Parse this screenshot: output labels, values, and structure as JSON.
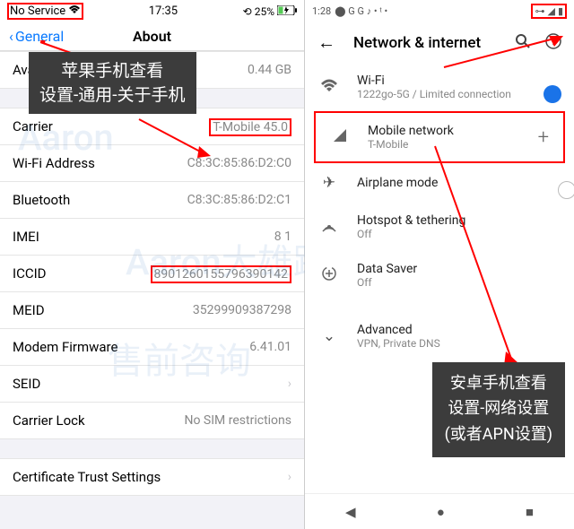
{
  "ios": {
    "status": {
      "service": "No Service",
      "time": "17:35",
      "battery": "25%"
    },
    "nav": {
      "back": "General",
      "title": "About"
    },
    "overlay": {
      "line1": "苹果手机查看",
      "line2": "设置-通用-关于手机"
    },
    "rows": {
      "available": {
        "label": "Available",
        "value": "0.44 GB"
      },
      "carrier": {
        "label": "Carrier",
        "value": "T-Mobile 45.0"
      },
      "wifi": {
        "label": "Wi-Fi Address",
        "value": "C8:3C:85:86:D2:C0"
      },
      "bluetooth": {
        "label": "Bluetooth",
        "value": "C8:3C:85:86:D2:C1"
      },
      "imei": {
        "label": "IMEI",
        "value": "8 1"
      },
      "iccid": {
        "label": "ICCID",
        "value": "8901260155796390142"
      },
      "meid": {
        "label": "MEID",
        "value": "35299909387298"
      },
      "modem": {
        "label": "Modem Firmware",
        "value": "6.41.01"
      },
      "seid": {
        "label": "SEID",
        "value": ""
      },
      "carrier_lock": {
        "label": "Carrier Lock",
        "value": "No SIM restrictions"
      },
      "cert": {
        "label": "Certificate Trust Settings",
        "value": ""
      }
    }
  },
  "android": {
    "status": {
      "time": "1:28",
      "dots": "G G"
    },
    "nav": {
      "title": "Network & internet"
    },
    "overlay": {
      "line1": "安卓手机查看",
      "line2": "设置-网络设置",
      "line3": "(或者APN设置)"
    },
    "rows": {
      "wifi": {
        "label": "Wi-Fi",
        "sub": "1222go-5G / Limited connection"
      },
      "mobile": {
        "label": "Mobile network",
        "sub": "T-Mobile"
      },
      "airplane": {
        "label": "Airplane mode"
      },
      "hotspot": {
        "label": "Hotspot & tethering",
        "sub": "Off"
      },
      "datasaver": {
        "label": "Data Saver",
        "sub": "Off"
      },
      "advanced": {
        "label": "Advanced",
        "sub": "VPN, Private DNS"
      }
    }
  }
}
